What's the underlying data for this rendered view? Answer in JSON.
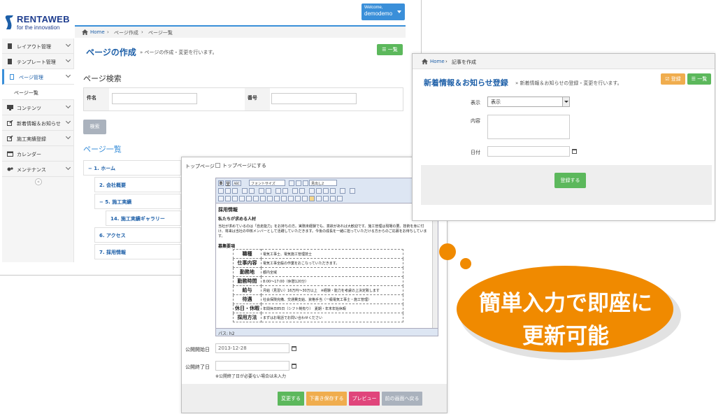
{
  "cms": {
    "logo": {
      "brand": "RENTAWEB",
      "tagline": "for the innovation"
    },
    "welcome": {
      "greeting": "Welcome,",
      "user": "demodemo"
    },
    "sidebar": {
      "items": [
        {
          "label": "レイアウト管理"
        },
        {
          "label": "テンプレート管理"
        },
        {
          "label": "ページ管理"
        },
        {
          "label": "ページ一覧"
        },
        {
          "label": "コンテンツ"
        },
        {
          "label": "新着情報＆お知らせ"
        },
        {
          "label": "施工実績登録"
        },
        {
          "label": "カレンダー"
        },
        {
          "label": "メンテナンス"
        }
      ],
      "collapse_glyph": "«"
    },
    "breadcrumb": {
      "home": "Home",
      "level1": "ページ作成",
      "level2": "ページ一覧"
    },
    "page_title": "ページの作成",
    "page_subtitle": "» ページの作成・変更を行います。",
    "list_button": "☰ 一覧",
    "search": {
      "title": "ページ検索",
      "field1_label": "件名",
      "field2_label": "番号",
      "button": "検索"
    },
    "page_list": {
      "title": "ページ一覧",
      "items": [
        "− 1. ホーム",
        "2. 会社概要",
        "− 5. 施工実績",
        "14. 施工実績ギャラリー",
        "6. アクセス",
        "7. 採用情報"
      ]
    }
  },
  "editor_window": {
    "top_page_label": "トップページ",
    "top_page_checkbox_label": "トップページにする",
    "toolbar": {
      "font_size": "フォントサイズ",
      "heading": "見出し2",
      "bold": "B",
      "italic": "U",
      "strike": "ABC"
    },
    "content": {
      "heading": "採用情報",
      "subheading": "私たちが求める人材",
      "paragraph": "当社が求めているのは「自走能力」をお持ちの方。実務未経験でも、意欲があれば大歓迎です。施工管理は現場の要。技術を身に付け、将来は当社の中核メンバーとして活躍していただきます。今後の成長を一緒に担っていただける方からのご応募をお待ちしています。",
      "section": "募集要項",
      "rows": [
        {
          "k": "職種",
          "v": "電気工事士、電気施工管理技士"
        },
        {
          "k": "仕事内容",
          "v": "電気工事全般の作業をおこなっていただきます。"
        },
        {
          "k": "勤務地",
          "v": "都内全域"
        },
        {
          "k": "勤務時間",
          "v": "8:00～17:00（休憩120分）"
        },
        {
          "k": "給与",
          "v": "月給（見習い）16万円～30万以上　※経験・能力を考慮の上決定致します"
        },
        {
          "k": "待遇",
          "v": "社会保険完備、交通費支給、資格手当（一級電気工事士・施工管理）"
        },
        {
          "k": "休日・休暇",
          "v": "年間休日85日（シフト制有り）　夏期・年末年始休暇"
        },
        {
          "k": "採用方法",
          "v": "まずはお電話でお問い合わせください"
        }
      ],
      "status_path": "パス: h2"
    },
    "publish_start_label": "公開開始日",
    "publish_start_value": "2013-12-28",
    "publish_end_label": "公開終了日",
    "publish_end_note": "※公開終了日が必要ない場合は未入力",
    "buttons": {
      "change": "変更する",
      "save_draft": "下書き保存する",
      "preview": "プレビュー",
      "back": "前の画面へ戻る"
    },
    "button_colors": {
      "change": "#5cb85c",
      "save_draft": "#f0ad4e",
      "preview": "#e0457b",
      "back": "#aab2bd"
    }
  },
  "news_window": {
    "breadcrumb": {
      "home": "Home",
      "level1": "記事を作成"
    },
    "title": "新着情報＆お知らせ登録",
    "subtitle": "» 新着情報＆お知らせの登録・変更を行います。",
    "top_register_button": "☑ 登録",
    "list_button": "☰ 一覧",
    "display_label": "表示",
    "display_value": "表示",
    "content_label": "内容",
    "date_label": "日付",
    "register_button": "登録する"
  },
  "callout": {
    "line1": "簡単入力で即座に",
    "line2": "更新可能",
    "color": "#f08a00"
  }
}
